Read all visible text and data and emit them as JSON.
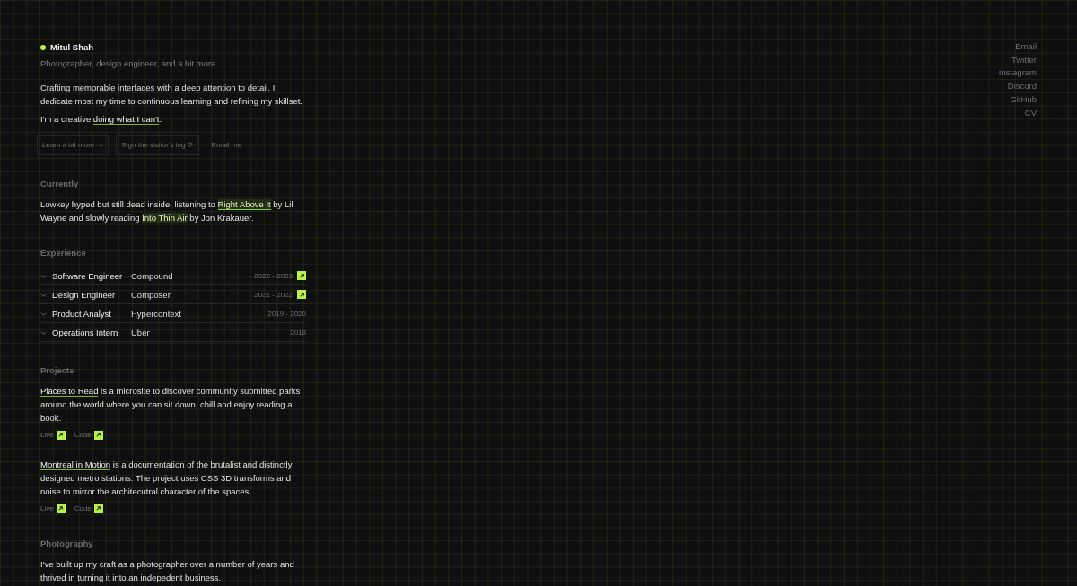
{
  "profile": {
    "name": "Mitul Shah",
    "online": true,
    "tagline": "Photographer, design engineer, and a bit more."
  },
  "intro": [
    [
      {
        "kind": "text",
        "text": "Crafting memorable interfaces with a deep attention to detail. I dedicate most my time to continuous learning and refining my skillset."
      }
    ],
    [
      {
        "kind": "text",
        "text": "I'm a creative "
      },
      {
        "kind": "link",
        "text": "doing what I can't"
      },
      {
        "kind": "text",
        "text": "."
      }
    ]
  ],
  "actions": [
    {
      "kind": "outlined",
      "label": "Learn a bit more →"
    },
    {
      "kind": "outlined",
      "label": "Sign the visitor's log ⟳"
    },
    {
      "kind": "plain",
      "label": "Email me"
    }
  ],
  "currently": {
    "heading": "Currently",
    "text": [
      {
        "kind": "text",
        "text": "Lowkey hyped but still dead inside, listening to "
      },
      {
        "kind": "highlight",
        "text": "Right Above It"
      },
      {
        "kind": "text",
        "text": " by Lil Wayne and slowly reading "
      },
      {
        "kind": "highlight",
        "text": "Into Thin Air"
      },
      {
        "kind": "text",
        "text": " by Jon Krakauer."
      }
    ]
  },
  "experience": {
    "heading": "Experience",
    "rows": [
      {
        "role": "Software Engineer",
        "company": "Compound",
        "years": "2022 - 2023",
        "has_link": true
      },
      {
        "role": "Design Engineer",
        "company": "Composer",
        "years": "2021 - 2022",
        "has_link": true
      },
      {
        "role": "Product Analyst",
        "company": "Hypercontext",
        "years": "2019 - 2020",
        "has_link": false
      },
      {
        "role": "Operations Intern",
        "company": "Uber",
        "years": "2018",
        "has_link": false
      }
    ]
  },
  "projects": {
    "heading": "Projects",
    "items": [
      {
        "title": "Places to Read",
        "description": " is a microsite to discover community submitted parks around the world where you can sit down, chill and enjoy reading a book.",
        "links": [
          "Live",
          "Code"
        ]
      },
      {
        "title": "Montreal in Motion",
        "description": " is a documentation of the brutalist and distinctly designed metro stations. The project uses CSS 3D transforms and noise to mirror the architecutral character of the spaces.",
        "links": [
          "Live",
          "Code"
        ]
      }
    ]
  },
  "photography": {
    "heading": "Photography",
    "text": "I've built up my craft as a photographer over a number of years and thrived in turning it into an indepedent business."
  },
  "social_links": [
    "Email",
    "Twitter",
    "Instagram",
    "Discord",
    "GitHub",
    "CV"
  ]
}
